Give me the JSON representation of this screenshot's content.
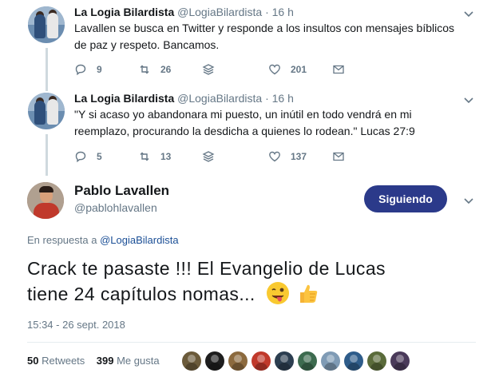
{
  "thread": [
    {
      "name": "La Logia Bilardista",
      "handle": "@LogiaBilardista",
      "dot": "·",
      "time": "16 h",
      "text": "Lavallen se busca en Twitter y responde a los insultos con mensajes bíblicos de paz y respeto. Bancamos.",
      "replies": "9",
      "retweets": "26",
      "likes": "201"
    },
    {
      "name": "La Logia Bilardista",
      "handle": "@LogiaBilardista",
      "dot": "·",
      "time": "16 h",
      "text": "\"Y si acaso yo abandonara mi puesto, un inútil en todo vendrá en mi reemplazo, procurando la desdicha a quienes lo rodean.\" Lucas 27:9",
      "replies": "5",
      "retweets": "13",
      "likes": "137"
    }
  ],
  "main": {
    "name": "Pablo Lavallen",
    "handle": "@pablohlavallen",
    "follow_label": "Siguiendo",
    "reply_prefix": "En respuesta a",
    "reply_mention": "@LogiaBilardista",
    "text_line1": "Crack te pasaste !!! El Evangelio de Lucas",
    "text_line2": "tiene 24 capítulos nomas...",
    "emojis": [
      "winking-face-with-tongue-emoji",
      "thumbs-up-emoji"
    ],
    "timestamp": "15:34 - 26 sept. 2018",
    "retweets_count": "50",
    "retweets_label": "Retweets",
    "likes_count": "399",
    "likes_label": "Me gusta"
  },
  "likers": [
    {
      "color": "#6b5a3a"
    },
    {
      "color": "#1e1e1e"
    },
    {
      "color": "#8c6a3e"
    },
    {
      "color": "#c0392b"
    },
    {
      "color": "#2c3e50"
    },
    {
      "color": "#3d6b4f"
    },
    {
      "color": "#7f9bb5"
    },
    {
      "color": "#2e5c8a"
    },
    {
      "color": "#5a6b3a"
    },
    {
      "color": "#4a3a5a"
    }
  ],
  "colors": {
    "follow_button": "#2b3a8a",
    "mention": "#1b4f96",
    "secondary_text": "#657786",
    "thread_line": "#cfd9de"
  }
}
